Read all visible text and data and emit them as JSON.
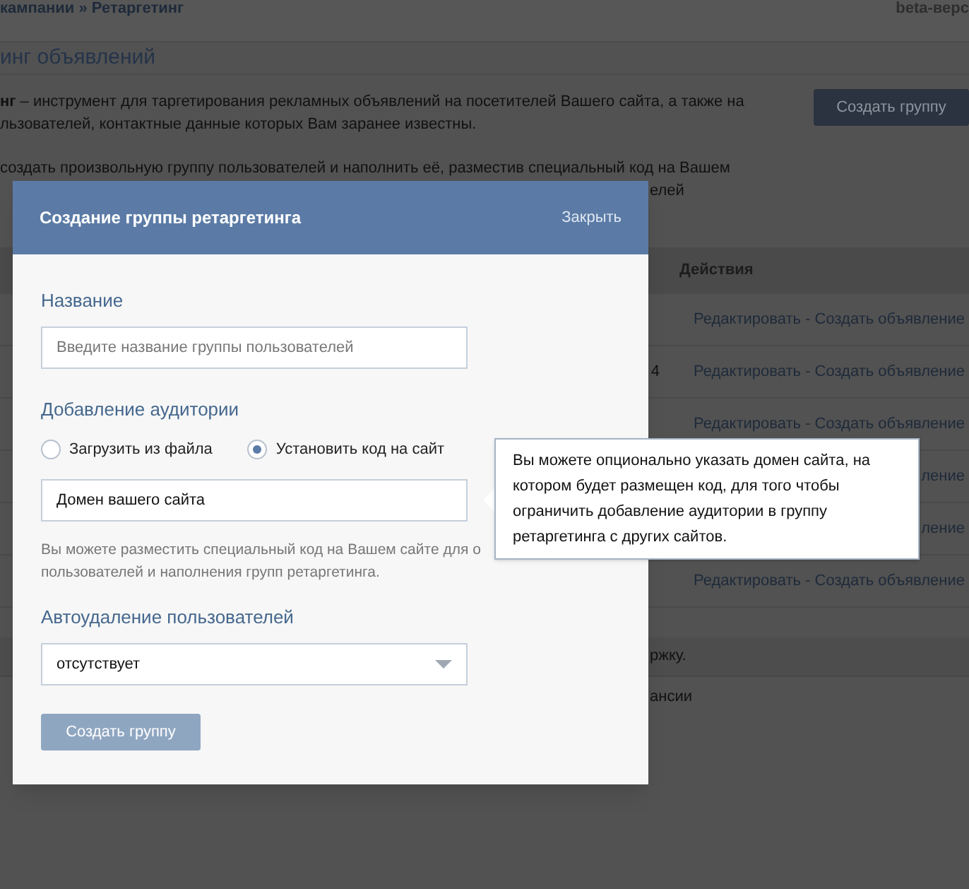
{
  "page": {
    "breadcrumb": "кампании » Ретаргетинг",
    "beta_label": "beta-верс",
    "title": "инг объявлений",
    "intro_lines": [
      "**нг** – инструмент для таргетирования рекламных объявлений на посетителей Вашего сайта, а также на",
      "льзователей, контактные данные которых Вам заранее известны."
    ],
    "create_button": "Создать группу",
    "info_lines": [
      "создать произвольную группу пользователей и наполнить её, разместив специальный код на Вашем",
      "елей"
    ],
    "table": {
      "header": "Действия",
      "rows": [
        {
          "column_1": "",
          "actions": "Редактировать - Создать объявление"
        },
        {
          "column_1": "4",
          "actions": "Редактировать - Создать объявление"
        },
        {
          "column_1": "",
          "actions": "Редактировать - Создать объявление"
        },
        {
          "column_1": "",
          "actions": "ление"
        },
        {
          "column_1": "",
          "actions": "ление"
        },
        {
          "column_1": "",
          "actions": "Редактировать - Создать объявление"
        }
      ]
    },
    "footer_lines": [
      "ржку.",
      "ансии"
    ]
  },
  "dialog": {
    "title": "Создание группы ретаргетинга",
    "close": "Закрыть",
    "name_label": "Название",
    "name_field": {
      "placeholder": "Введите название группы пользователей"
    },
    "audience_label": "Добавление аудитории",
    "audience_options": [
      {
        "label": "Загрузить из файла",
        "selected": false
      },
      {
        "label": "Установить код на сайт",
        "selected": true
      }
    ],
    "domain_field": {
      "value": "Домен вашего сайта"
    },
    "help_lines": [
      "Вы можете разместить специальный код на Вашем сайте для о",
      "пользователей и наполнения групп ретаргетинга."
    ],
    "autodelete_label": "Автоудаление пользователей",
    "autodelete_select": {
      "value": "отсутствует"
    },
    "submit": "Создать группу"
  },
  "tooltip": {
    "text": "Вы можете опционально указать домен сайта, на котором будет размещен код, для того чтобы ограничить добавление аудитории в группу ретаргетинга с других сайтов."
  }
}
